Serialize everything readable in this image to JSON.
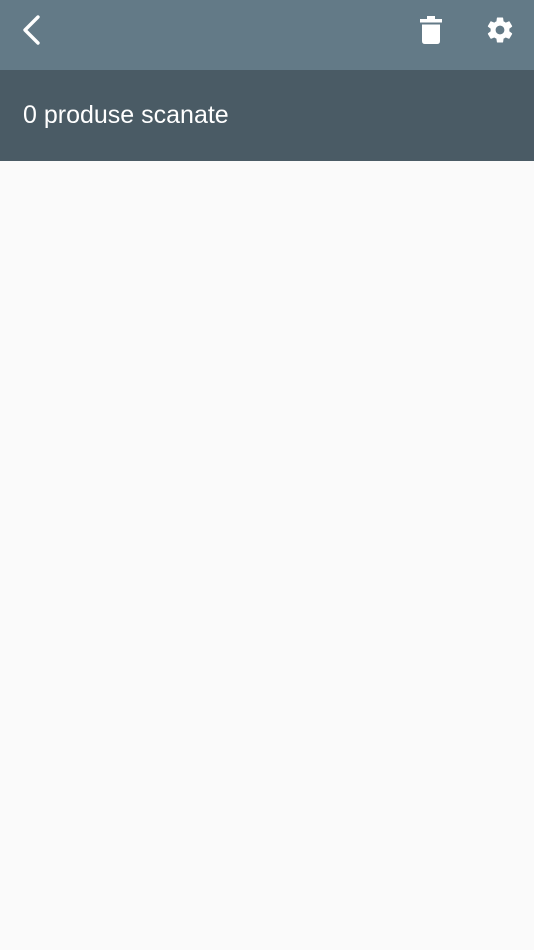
{
  "colors": {
    "toolbar_bg": "#637a87",
    "summary_bg": "#4a5b65",
    "content_bg": "#fafafa",
    "icon_color": "#ffffff"
  },
  "toolbar": {
    "back_icon": "chevron-left-icon",
    "delete_icon": "trash-icon",
    "settings_icon": "gear-icon"
  },
  "summary": {
    "text": "0 produse scanate"
  },
  "list": {
    "items": []
  }
}
